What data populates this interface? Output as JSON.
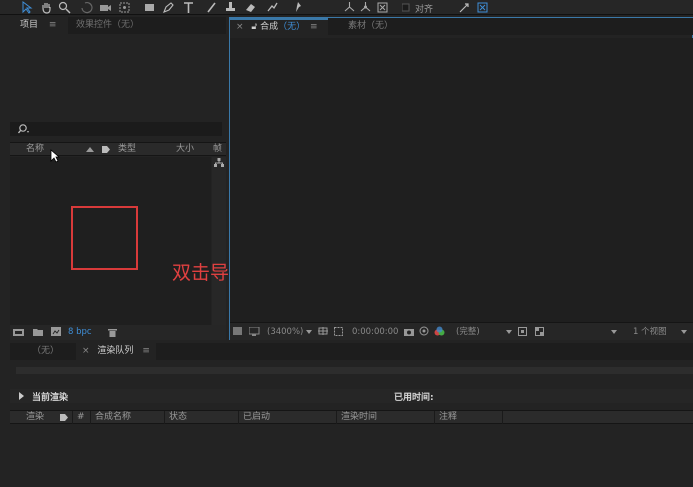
{
  "toolbar": {
    "tools": [
      "selection-tool-icon",
      "hand-tool-icon",
      "zoom-tool-icon",
      "rotate-tool-icon",
      "camera-tool-icon",
      "pan-behind-tool-icon",
      "rectangle-tool-icon",
      "pen-tool-icon",
      "type-tool-icon",
      "brush-tool-icon",
      "clone-stamp-tool-icon",
      "eraser-tool-icon",
      "roto-brush-tool-icon",
      "puppet-pin-tool-icon",
      "axis-icon",
      "local-axis-icon",
      "world-axis-icon"
    ],
    "snap_label": "对齐"
  },
  "project_panel": {
    "tab_project": "项目",
    "tab_effects": "效果控件（无）",
    "columns": {
      "name": "名称",
      "type": "类型",
      "size": "大小",
      "frame": "帧"
    },
    "bpc": "8 bpc"
  },
  "comp_panel": {
    "tab_comp_label": "合成",
    "tab_comp_value": "（无）",
    "tab_footage": "素材（无）",
    "zoom": "(3400%)",
    "timecode": "0:00:00:00",
    "quality": "(完整)",
    "views": "1 个视图"
  },
  "render_panel": {
    "tab_none": "（无）",
    "tab_render_queue": "渲染队列",
    "current_render": "当前渲染",
    "elapsed_time": "已用时间:",
    "columns": [
      "渲染",
      "#",
      "合成名称",
      "状态",
      "已启动",
      "渲染时间",
      "注释"
    ]
  },
  "annotation": {
    "text": "双击导入素材",
    "color": "#d83a3a"
  },
  "colors": {
    "accent": "#3a78a8",
    "bpc": "#3f8fd8"
  }
}
